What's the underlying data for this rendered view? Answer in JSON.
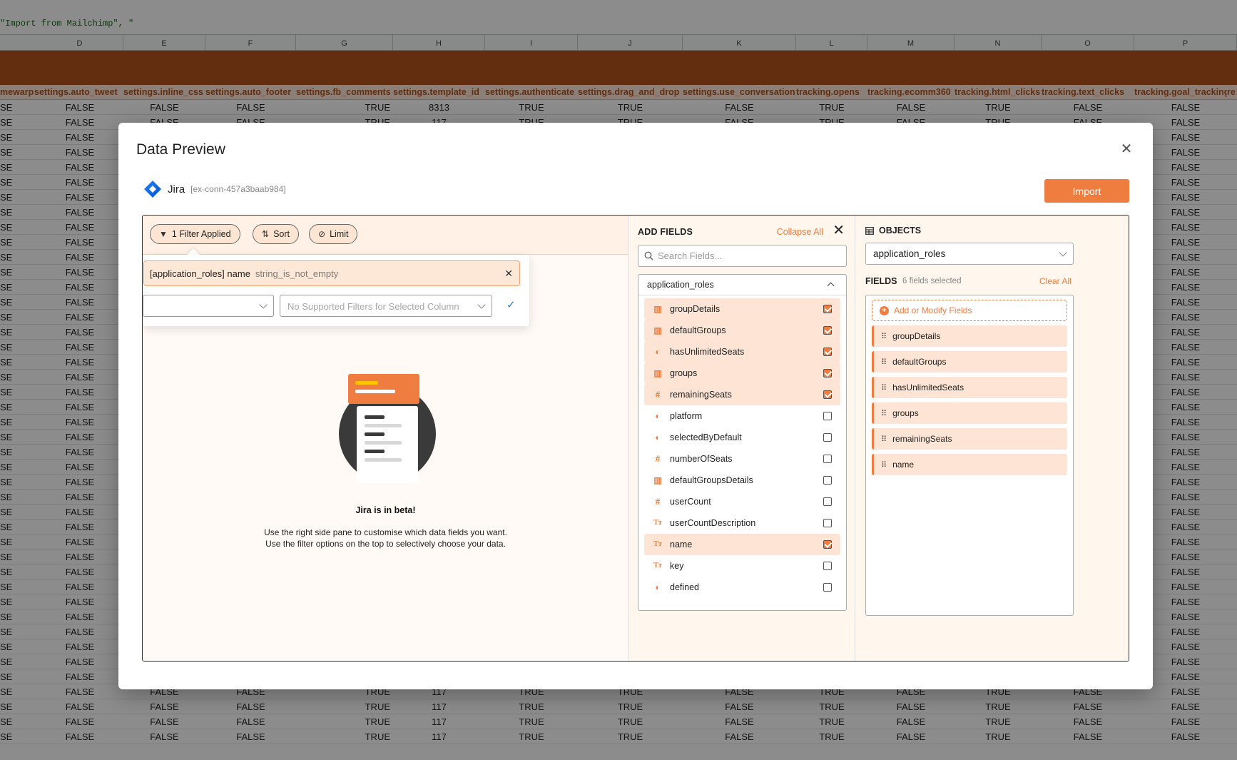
{
  "sheet": {
    "formula_text": "\"Import from Mailchimp\", \"",
    "columns": [
      "D",
      "E",
      "F",
      "G",
      "H",
      "I",
      "J",
      "K",
      "L",
      "M",
      "N",
      "O",
      "P"
    ],
    "field_names": [
      "mewarp",
      "settings.auto_tweet",
      "settings.inline_css",
      "settings.auto_footer",
      "settings.fb_comments",
      "settings.template_id",
      "settings.authenticate",
      "settings.drag_and_drop",
      "settings.use_conversation",
      "tracking.opens",
      "tracking.ecomm360",
      "tracking.html_clicks",
      "tracking.text_clicks",
      "tracking.goal_tracking",
      "re"
    ],
    "row_first": [
      "SE",
      "FALSE",
      "FALSE",
      "FALSE",
      "TRUE",
      "8313",
      "TRUE",
      "TRUE",
      "FALSE",
      "TRUE",
      "FALSE",
      "TRUE",
      "FALSE",
      "FALSE"
    ],
    "row_repeat": [
      "SE",
      "FALSE",
      "FALSE",
      "FALSE",
      "TRUE",
      "117",
      "TRUE",
      "TRUE",
      "FALSE",
      "TRUE",
      "FALSE",
      "TRUE",
      "FALSE",
      "FALSE"
    ],
    "left_fragment": "SE",
    "false_text": "FALSE"
  },
  "modal": {
    "title": "Data Preview",
    "connection_name": "Jira",
    "connection_id": "[ex-conn-457a3baab984]",
    "import_label": "Import"
  },
  "toolbar": {
    "filter_label": "1 Filter Applied",
    "sort_label": "Sort",
    "limit_label": "Limit"
  },
  "filter": {
    "column": "[application_roles] name",
    "operator": "string_is_not_empty",
    "value_placeholder": "No Supported Filters for Selected Column"
  },
  "empty_state": {
    "title": "Jira is in beta!",
    "line1": "Use the right side pane to customise which data fields you want.",
    "line2": "Use the filter options on the top to selectively choose your data."
  },
  "add_fields": {
    "heading": "ADD FIELDS",
    "collapse_all": "Collapse All",
    "search_placeholder": "Search Fields...",
    "group_name": "application_roles",
    "items": [
      {
        "label": "groupDetails",
        "icon": "array-icon",
        "checked": true
      },
      {
        "label": "defaultGroups",
        "icon": "array-icon",
        "checked": true
      },
      {
        "label": "hasUnlimitedSeats",
        "icon": "boolean-icon",
        "checked": true
      },
      {
        "label": "groups",
        "icon": "array-icon",
        "checked": true
      },
      {
        "label": "remainingSeats",
        "icon": "number-icon",
        "checked": true
      },
      {
        "label": "platform",
        "icon": "boolean-icon",
        "checked": false
      },
      {
        "label": "selectedByDefault",
        "icon": "boolean-icon",
        "checked": false
      },
      {
        "label": "numberOfSeats",
        "icon": "number-icon",
        "checked": false
      },
      {
        "label": "defaultGroupsDetails",
        "icon": "array-icon",
        "checked": false
      },
      {
        "label": "userCount",
        "icon": "number-icon",
        "checked": false
      },
      {
        "label": "userCountDescription",
        "icon": "text-icon",
        "checked": false
      },
      {
        "label": "name",
        "icon": "text-icon",
        "checked": true
      },
      {
        "label": "key",
        "icon": "text-icon",
        "checked": false
      },
      {
        "label": "defined",
        "icon": "boolean-icon",
        "checked": false
      }
    ]
  },
  "objects": {
    "heading": "OBJECTS",
    "selected_object": "application_roles",
    "fields_heading": "FIELDS",
    "fields_count": "6 fields selected",
    "clear_all": "Clear All",
    "add_modify": "Add or Modify Fields",
    "selected_fields": [
      "groupDetails",
      "defaultGroups",
      "hasUnlimitedSeats",
      "groups",
      "remainingSeats",
      "name"
    ]
  },
  "colors": {
    "accent": "#ef7d3f",
    "sheet_band": "#b4531c"
  }
}
